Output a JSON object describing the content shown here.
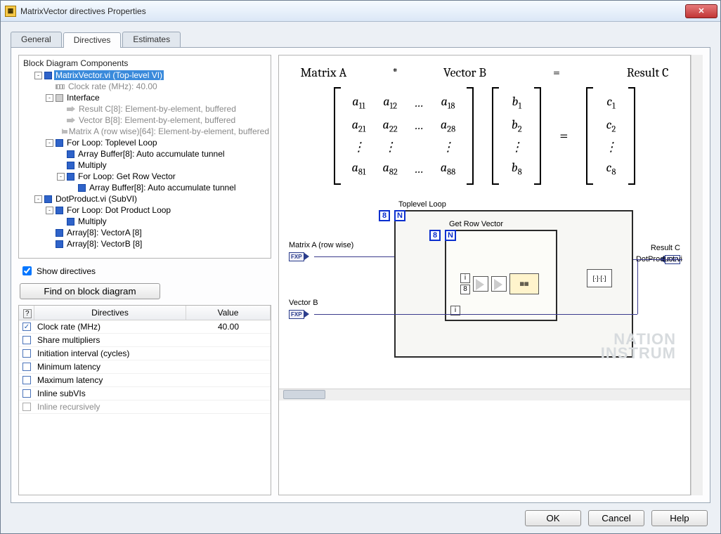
{
  "window": {
    "title": "MatrixVector directives Properties"
  },
  "tabs": [
    "General",
    "Directives",
    "Estimates"
  ],
  "activeTab": 1,
  "tree": {
    "title": "Block Diagram Components",
    "nodes": [
      {
        "depth": 1,
        "twisty": "-",
        "icon": "sq",
        "text": "MatrixVector.vi (Top-level VI)",
        "selected": true
      },
      {
        "depth": 2,
        "twisty": "",
        "icon": "stripe",
        "text": "Clock rate (MHz): 40.00",
        "grey": true
      },
      {
        "depth": 2,
        "twisty": "-",
        "icon": "sqgrey",
        "text": "Interface"
      },
      {
        "depth": 3,
        "twisty": "",
        "icon": "arrow",
        "text": "Result C[8]: Element-by-element, buffered",
        "grey": true
      },
      {
        "depth": 3,
        "twisty": "",
        "icon": "arrow",
        "text": "Vector B[8]: Element-by-element, buffered",
        "grey": true
      },
      {
        "depth": 3,
        "twisty": "",
        "icon": "arrow",
        "text": "Matrix A (row wise)[64]: Element-by-element, buffered",
        "grey": true
      },
      {
        "depth": 2,
        "twisty": "-",
        "icon": "sq",
        "text": "For Loop: Toplevel Loop"
      },
      {
        "depth": 3,
        "twisty": "",
        "icon": "sq",
        "text": "Array Buffer[8]: Auto accumulate tunnel"
      },
      {
        "depth": 3,
        "twisty": "",
        "icon": "sq",
        "text": "Multiply"
      },
      {
        "depth": 3,
        "twisty": "-",
        "icon": "sq",
        "text": "For Loop: Get Row Vector"
      },
      {
        "depth": 4,
        "twisty": "",
        "icon": "sq",
        "text": "Array Buffer[8]: Auto accumulate tunnel"
      },
      {
        "depth": 1,
        "twisty": "-",
        "icon": "sq",
        "text": "DotProduct.vi (SubVI)"
      },
      {
        "depth": 2,
        "twisty": "-",
        "icon": "sq",
        "text": "For Loop: Dot Product Loop"
      },
      {
        "depth": 3,
        "twisty": "",
        "icon": "sq",
        "text": "Multiply"
      },
      {
        "depth": 2,
        "twisty": "",
        "icon": "sq",
        "text": "Array[8]: VectorA [8]"
      },
      {
        "depth": 2,
        "twisty": "",
        "icon": "sq",
        "text": "Array[8]: VectorB [8]"
      }
    ]
  },
  "showDirectives": {
    "label": "Show directives",
    "checked": true
  },
  "findButton": "Find on block diagram",
  "directivesTable": {
    "headers": {
      "q": "?",
      "d": "Directives",
      "v": "Value"
    },
    "rows": [
      {
        "checked": true,
        "name": "Clock rate (MHz)",
        "value": "40.00"
      },
      {
        "checked": false,
        "name": "Share multipliers",
        "value": ""
      },
      {
        "checked": false,
        "name": "Initiation interval (cycles)",
        "value": ""
      },
      {
        "checked": false,
        "name": "Minimum latency",
        "value": ""
      },
      {
        "checked": false,
        "name": "Maximum latency",
        "value": ""
      },
      {
        "checked": false,
        "name": "Inline subVIs",
        "value": ""
      },
      {
        "checked": false,
        "name": "Inline recursively",
        "value": "",
        "sub": true,
        "disabled": true
      }
    ]
  },
  "formula": {
    "h1": "Matrix A",
    "h2": "*",
    "h3": "Vector B",
    "h4": "=",
    "h5": "Result C",
    "A": [
      [
        "a",
        "11"
      ],
      [
        "a",
        "12"
      ],
      "…",
      [
        "a",
        "18"
      ],
      [
        "a",
        "21"
      ],
      [
        "a",
        "22"
      ],
      "…",
      [
        "a",
        "28"
      ],
      "⋮",
      "⋮",
      " ",
      "⋮",
      [
        "a",
        "81"
      ],
      [
        "a",
        "82"
      ],
      "…",
      [
        "a",
        "88"
      ]
    ],
    "Bs": [
      "1",
      "2",
      "⋮",
      "8"
    ],
    "Cs": [
      "1",
      "2",
      "⋮",
      "8"
    ]
  },
  "diagram": {
    "matrixA": "Matrix A (row wise)",
    "vectorB": "Vector B",
    "resultC": "Result C",
    "toplevel": "Toplevel Loop",
    "getrow": "Get Row Vector",
    "dotprod": "DotProduct.vi",
    "eight": "8",
    "N": "N",
    "i": "i"
  },
  "buttons": {
    "ok": "OK",
    "cancel": "Cancel",
    "help": "Help"
  },
  "watermark": "NATION\nINSTRUM"
}
